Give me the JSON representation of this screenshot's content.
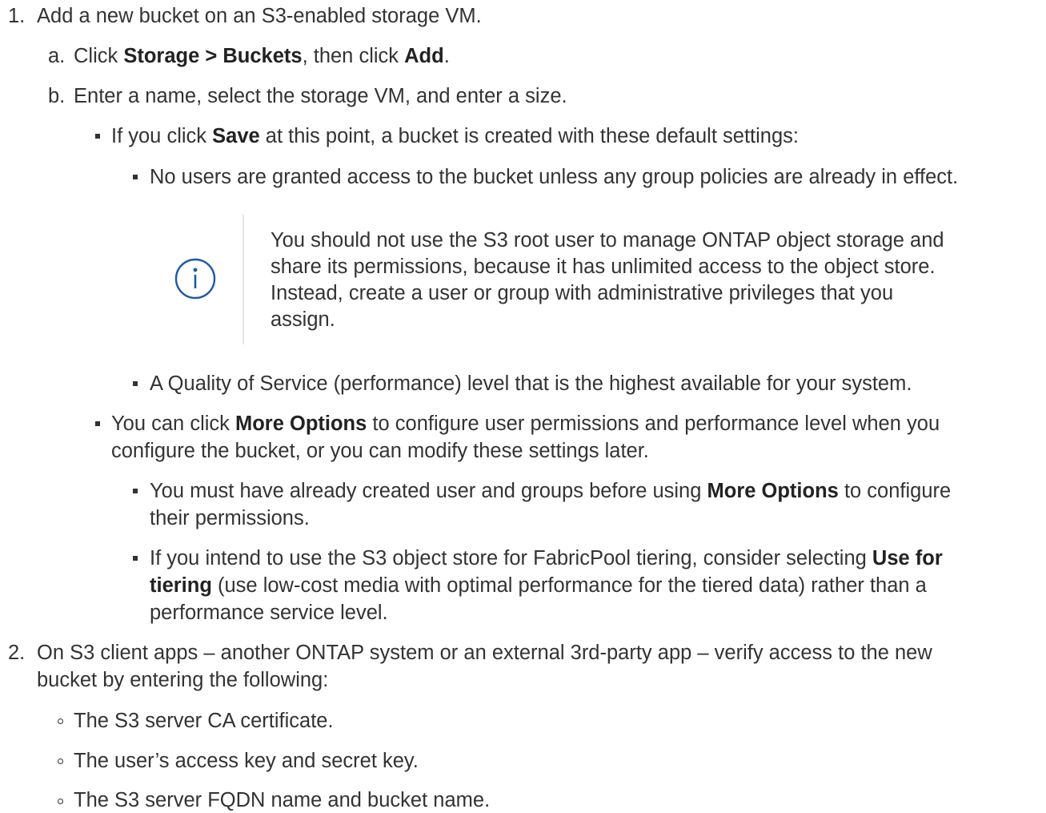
{
  "steps": [
    {
      "number": "1.",
      "text": "Add a new bucket on an S3-enabled storage VM.",
      "substeps": [
        {
          "marker": "a.",
          "parts": [
            "Click ",
            "Storage > Buckets",
            ", then click ",
            "Add",
            "."
          ]
        },
        {
          "marker": "b.",
          "text": "Enter a name, select the storage VM, and enter a size.",
          "bullets": [
            {
              "parts": [
                "If you click ",
                "Save",
                " at this point, a bucket is created with these default settings:"
              ],
              "sub_bullets": [
                "No users are granted access to the bucket unless any group policies are already in effect.",
                "A Quality of Service (performance) level that is the highest available for your system."
              ],
              "note": {
                "icon": "info-icon",
                "lines": [
                  "You should not use the S3 root user to manage ONTAP object storage and",
                  "share its permissions, because it has unlimited access to the object store.",
                  "Instead, create a user or group with administrative privileges that you",
                  "assign."
                ]
              }
            },
            {
              "line1_parts": [
                "You can click ",
                "More Options",
                " to configure user permissions and performance level when you"
              ],
              "line2": "configure the bucket, or you can modify these settings later.",
              "sub_bullets": [
                {
                  "line1_parts": [
                    "You must have already created user and groups before using ",
                    "More Options",
                    " to configure"
                  ],
                  "line2": "their permissions."
                },
                {
                  "line1_parts": [
                    "If you intend to use the S3 object store for FabricPool tiering, consider selecting ",
                    "Use for"
                  ],
                  "line2_parts": [
                    "tiering",
                    " (use low-cost media with optimal performance for the tiered data) rather than a"
                  ],
                  "line3": "performance service level."
                }
              ]
            }
          ]
        }
      ]
    },
    {
      "number": "2.",
      "lines": [
        "On S3 client apps – another ONTAP system or an external 3rd-party app – verify access to the new",
        "bucket by entering the following:"
      ],
      "items": [
        "The S3 server CA certificate.",
        "The user’s access key and secret key.",
        "The S3 server FQDN name and bucket name."
      ]
    }
  ]
}
